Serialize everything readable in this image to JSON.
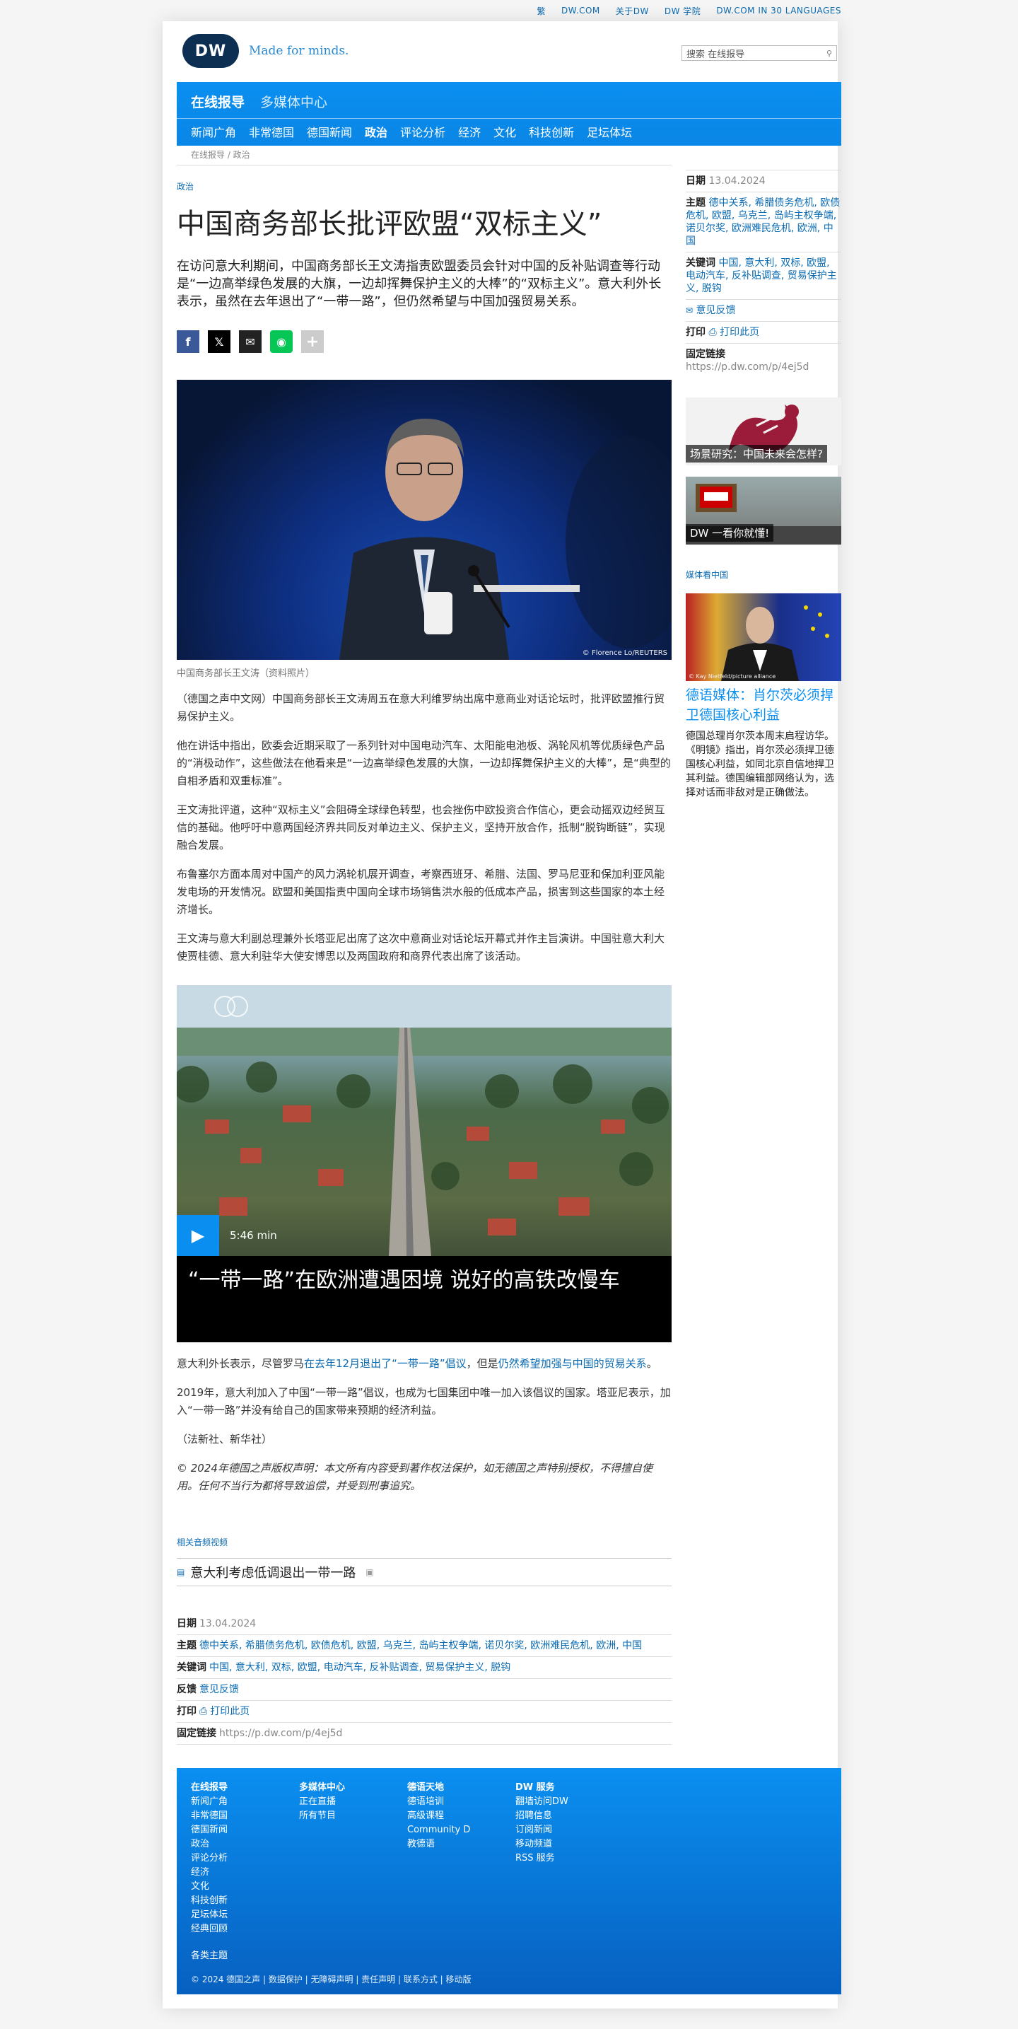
{
  "topbar": {
    "links": [
      "繁",
      "DW.COM",
      "关于DW",
      "DW 学院",
      "DW.COM IN 30 LANGUAGES"
    ]
  },
  "header": {
    "logo": "DW",
    "tagline": "Made for minds.",
    "search_placeholder": "搜索 在线报导"
  },
  "nav": {
    "tabs": [
      "在线报导",
      "多媒体中心"
    ],
    "items": [
      "新闻广角",
      "非常德国",
      "德国新闻",
      "政治",
      "评论分析",
      "经济",
      "文化",
      "科技创新",
      "足坛体坛"
    ]
  },
  "breadcrumb": "在线报导 / 政治",
  "article": {
    "kicker": "政治",
    "title": "中国商务部长批评欧盟“双标主义”",
    "lead": "在访问意大利期间，中国商务部长王文涛指责欧盟委员会针对中国的反补贴调查等行动是“一边高举绿色发展的大旗，一边却挥舞保护主义的大棒”的“双标主义”。意大利外长表示，虽然在去年退出了“一带一路”，但仍然希望与中国加强贸易关系。",
    "photo_credit": "© Florence Lo/REUTERS",
    "photo_caption": "中国商务部长王文涛（资料照片）",
    "paragraphs": [
      "（德国之声中文网）中国商务部长王文涛周五在意大利维罗纳出席中意商业对话论坛时，批评欧盟推行贸易保护主义。",
      "他在讲话中指出，欧委会近期采取了一系列针对中国电动汽车、太阳能电池板、涡轮风机等优质绿色产品的“消极动作”，这些做法在他看来是“一边高举绿色发展的大旗，一边却挥舞保护主义的大棒”，是“典型的自相矛盾和双重标准”。",
      "王文涛批评道，这种“双标主义”会阻碍全球绿色转型，也会挫伤中欧投资合作信心，更会动摇双边经贸互信的基础。他呼吁中意两国经济界共同反对单边主义、保护主义，坚持开放合作，抵制“脱钩断链”，实现融合发展。",
      "布鲁塞尔方面本周对中国产的风力涡轮机展开调查，考察西班牙、希腊、法国、罗马尼亚和保加利亚风能发电场的开发情况。欧盟和美国指责中国向全球市场销售洪水般的低成本产品，损害到这些国家的本土经济增长。",
      "王文涛与意大利副总理兼外长塔亚尼出席了这次中意商业对话论坛开幕式并作主旨演讲。中国驻意大利大使贾桂德、意大利驻华大使安博思以及两国政府和商界代表出席了该活动。"
    ],
    "video": {
      "duration": "5:46 min",
      "title": "“一带一路”在欧洲遭遇困境 说好的高铁改慢车"
    },
    "para_after_1": "意大利外长表示，尽管罗马",
    "para_after_1_link1": "在去年12月退出了“一带一路”倡议",
    "para_after_1_mid": "，但是",
    "para_after_1_link2": "仍然希望加强与中国的贸易关系",
    "para_after_1_end": "。",
    "para_after_2": "2019年，意大利加入了中国“一带一路”倡议，也成为七国集团中唯一加入该倡议的国家。塔亚尼表示，加入“一带一路”并没有给自己的国家带来预期的经济利益。",
    "source": "（法新社、新华社）",
    "legal": "© 2024年德国之声版权声明：本文所有内容受到著作权法保护，如无德国之声特别授权，不得擅自使用。任何不当行为都将导致追偿，并受到刑事追究。",
    "related_label": "相关音频视频",
    "related_item": "意大利考虑低调退出一带一路"
  },
  "meta": {
    "date_label": "日期",
    "date": "13.04.2024",
    "topics_label": "主题",
    "topics": "德中关系, 希腊债务危机, 欧债危机, 欧盟, 乌克兰, 岛屿主权争端, 诺贝尔奖, 欧洲难民危机, 欧洲, 中国",
    "keywords_label": "关键词",
    "keywords": "中国, 意大利, 双标, 欧盟, 电动汽车, 反补贴调查, 贸易保护主义, 脱钩",
    "feedback_label": "反馈",
    "feedback": "意见反馈",
    "print_label": "打印",
    "print": "打印此页",
    "permalink_label": "固定链接",
    "permalink": "https://p.dw.com/p/4ej5d"
  },
  "sidebar": {
    "date_label": "日期",
    "date": "13.04.2024",
    "topics_label": "主题",
    "topics": "德中关系, 希腊债务危机, 欧债危机, 欧盟, 乌克兰, 岛屿主权争端, 诺贝尔奖, 欧洲难民危机, 欧洲, 中国",
    "keywords_label": "关键词",
    "keywords": "中国, 意大利, 双标, 欧盟, 电动汽车, 反补贴调查, 贸易保护主义, 脱钩",
    "feedback": "意见反馈",
    "print_label": "打印",
    "print": "打印此页",
    "permalink_label": "固定链接",
    "permalink": "https://p.dw.com/p/4ej5d",
    "promo1": "场景研究：中国未来会怎样?",
    "promo2": "DW 一看你就懂!",
    "media_label": "媒体看中国",
    "story_credit": "© Kay Nietfeld/picture alliance",
    "story_title": "德语媒体：肖尔茨必须捍卫德国核心利益",
    "story_text": "德国总理肖尔茨本周末启程访华。《明镜》指出，肖尔茨必须捍卫德国核心利益，如同北京自信地捍卫其利益。德国编辑部网络认为，选择对话而非敌对是正确做法。"
  },
  "footer": {
    "col1_head": "在线报导",
    "col1": [
      "新闻广角",
      "非常德国",
      "德国新闻",
      "政治",
      "评论分析",
      "经济",
      "文化",
      "科技创新",
      "足坛体坛",
      "经典回顾"
    ],
    "col1_extra": "各类主题",
    "col2_head": "多媒体中心",
    "col2": [
      "正在直播",
      "所有节目"
    ],
    "col3_head": "德语天地",
    "col3": [
      "德语培训",
      "高级课程",
      "Community D",
      "教德语"
    ],
    "col4_head": "DW 服务",
    "col4": [
      "翻墙访问DW",
      "招聘信息",
      "订阅新闻",
      "移动频道",
      "RSS 服务"
    ],
    "copyright": "© 2024 德国之声 | 数据保护 | 无障碍声明 | 责任声明 | 联系方式 | 移动版"
  }
}
